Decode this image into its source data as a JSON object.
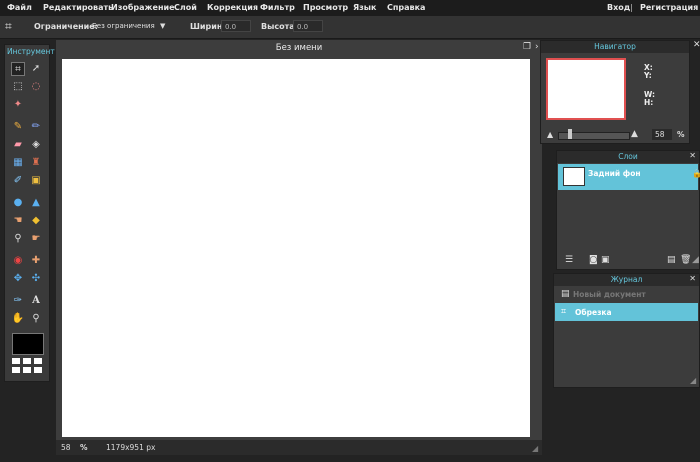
{
  "menu": {
    "items": [
      "Файл",
      "Редактировать",
      "Изображение",
      "Слой",
      "Коррекция",
      "Фильтр",
      "Просмотр",
      "Язык",
      "Справка"
    ],
    "login": "Вход",
    "separator": "|",
    "register": "Регистрация"
  },
  "options": {
    "constraint_label": "Ограничение:",
    "constraint_value": "Без ограничения",
    "width_label": "Ширина:",
    "width_value": "0.0",
    "height_label": "Высота:",
    "height_value": "0.0"
  },
  "toolbox": {
    "title": "Инструмент"
  },
  "document": {
    "title": "Без имени",
    "zoom": "58",
    "zoom_unit": "%",
    "size": "1179x951 px"
  },
  "navigator": {
    "title": "Навигатор",
    "x_label": "X:",
    "y_label": "Y:",
    "w_label": "W:",
    "h_label": "H:",
    "zoom": "58",
    "zoom_unit": "%"
  },
  "layers": {
    "title": "Слои",
    "items": [
      {
        "name": "Задний фон"
      }
    ]
  },
  "history": {
    "title": "Журнал",
    "items": [
      {
        "name": "Новый документ"
      },
      {
        "name": "Обрезка"
      }
    ]
  },
  "colors": {
    "accent": "#63c3d9",
    "accent_text": "#66c9df",
    "canvas": "#ffffff"
  }
}
